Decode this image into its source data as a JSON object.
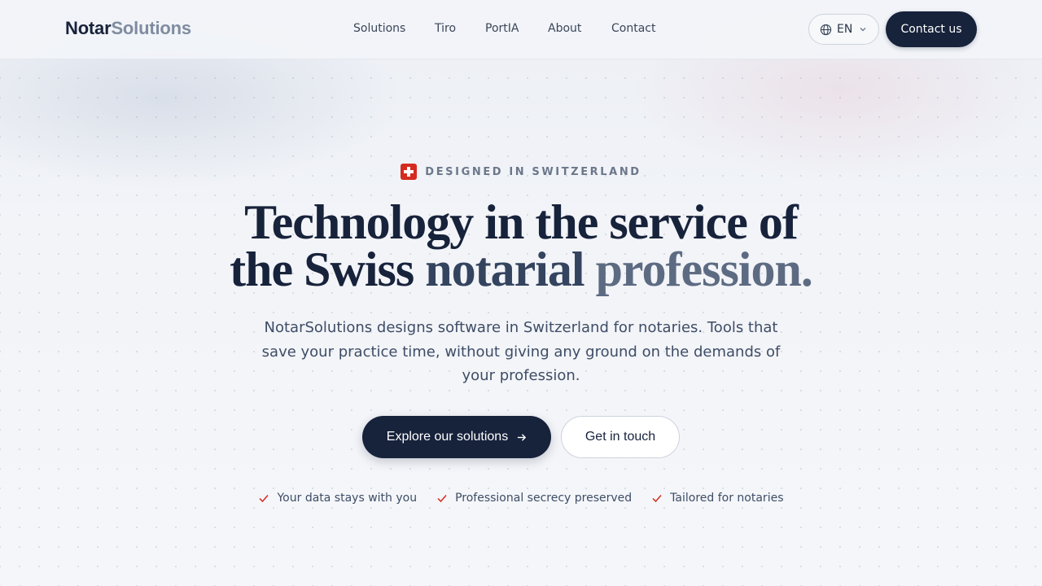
{
  "brand": {
    "name_a": "Notar",
    "name_b": "Solutions"
  },
  "nav": {
    "items": [
      {
        "label": "Solutions"
      },
      {
        "label": "Tiro"
      },
      {
        "label": "PortIA"
      },
      {
        "label": "About"
      },
      {
        "label": "Contact"
      }
    ]
  },
  "language": {
    "code": "EN",
    "icon": "globe-icon"
  },
  "header": {
    "contact_label": "Contact us"
  },
  "hero": {
    "eyebrow": "DESIGNED IN SWITZERLAND",
    "title_line1": "Technology in the service of",
    "title_line2_a": "the Swiss ",
    "title_line2_b": "notarial ",
    "title_line2_c": "profession.",
    "subtitle": "NotarSolutions designs software in Switzerland for notaries. Tools that save your practice time, without giving any ground on the demands of your profession.",
    "primary_cta": "Explore our solutions",
    "secondary_cta": "Get in touch"
  },
  "features": [
    {
      "label": "Your data stays with you"
    },
    {
      "label": "Professional secrecy preserved"
    },
    {
      "label": "Tailored for notaries"
    }
  ],
  "colors": {
    "primary": "#17223b",
    "accent_red": "#d52b1e",
    "muted": "#7f8ca0"
  }
}
